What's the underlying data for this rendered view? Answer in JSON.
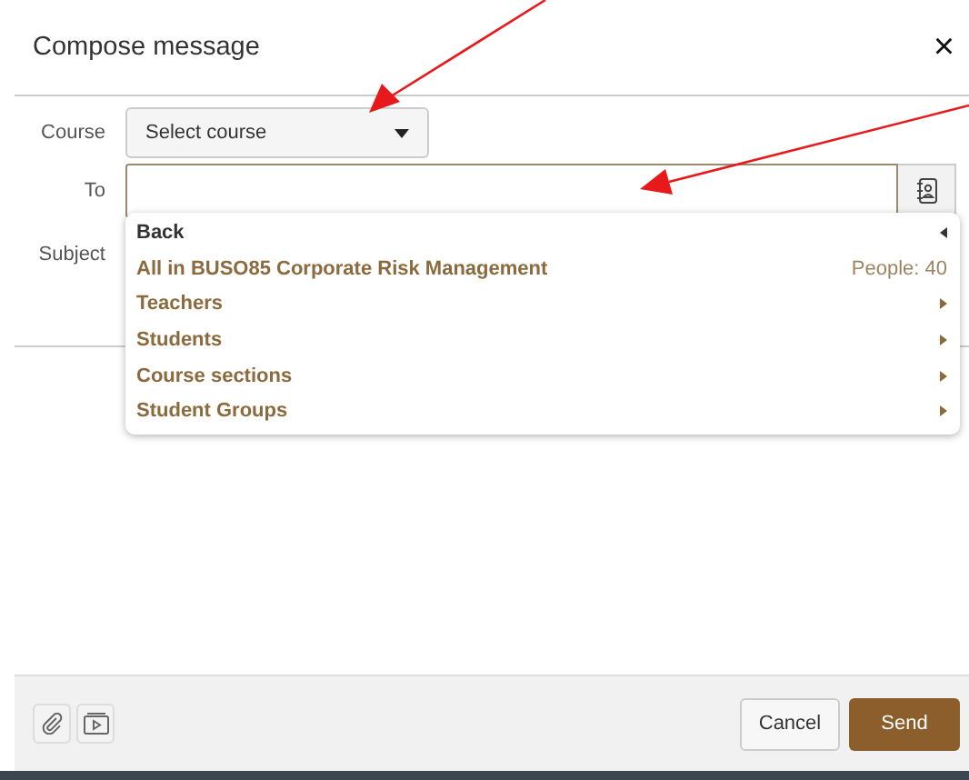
{
  "dialog": {
    "title": "Compose message",
    "close": "×"
  },
  "fields": {
    "course_label": "Course",
    "course_select": "Select course",
    "to_label": "To",
    "subject_label": "Subject"
  },
  "recipient_menu": [
    {
      "kind": "back",
      "label": "Back"
    },
    {
      "kind": "all",
      "label": "All in BUSO85 Corporate Risk Management",
      "count": "People: 40"
    },
    {
      "kind": "submenu",
      "label": "Teachers"
    },
    {
      "kind": "submenu",
      "label": "Students"
    },
    {
      "kind": "submenu",
      "label": "Course sections"
    },
    {
      "kind": "submenu",
      "label": "Student Groups"
    }
  ],
  "buttons": {
    "cancel": "Cancel",
    "send": "Send"
  }
}
